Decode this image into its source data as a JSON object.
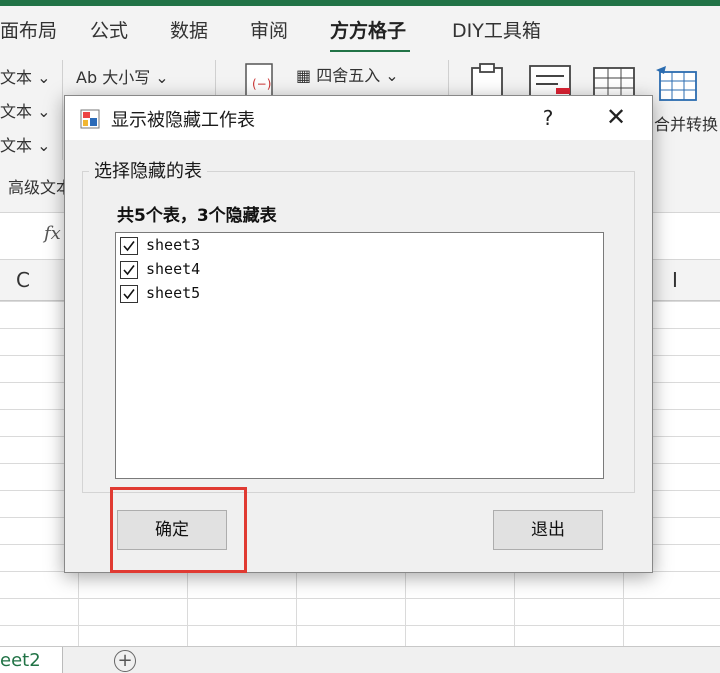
{
  "ribbon_tabs": [
    "面布局",
    "公式",
    "数据",
    "审阅",
    "方方格子",
    "DIY工具箱"
  ],
  "active_tab": "方方格子",
  "ribbon": {
    "left_items": [
      "文本",
      "文本",
      "文本"
    ],
    "group_label": "高级文本",
    "case_button": "Ab 大小写",
    "round_button": "四舍五入",
    "merge_convert": "合并转换"
  },
  "formula_bar": {
    "fx_symbol": "fx"
  },
  "column_headers": {
    "c": "C",
    "i": "I"
  },
  "sheet_tab": "eet2",
  "add_sheet": "+",
  "dialog": {
    "title": "显示被隐藏工作表",
    "help": "?",
    "close": "✕",
    "group_label": "选择隐藏的表",
    "summary": "共5个表，3个隐藏表",
    "sheets": [
      {
        "name": "sheet3",
        "checked": true
      },
      {
        "name": "sheet4",
        "checked": true
      },
      {
        "name": "sheet5",
        "checked": true
      }
    ],
    "ok_button": "确定",
    "exit_button": "退出"
  },
  "colors": {
    "excel_green": "#217346",
    "highlight_red": "#e03a32"
  },
  "icons": [
    "dialog-app-icon",
    "paste-icon",
    "round-icon",
    "table-icon",
    "merge-table-icon",
    "fx-icon",
    "checkbox-checked-icon"
  ]
}
